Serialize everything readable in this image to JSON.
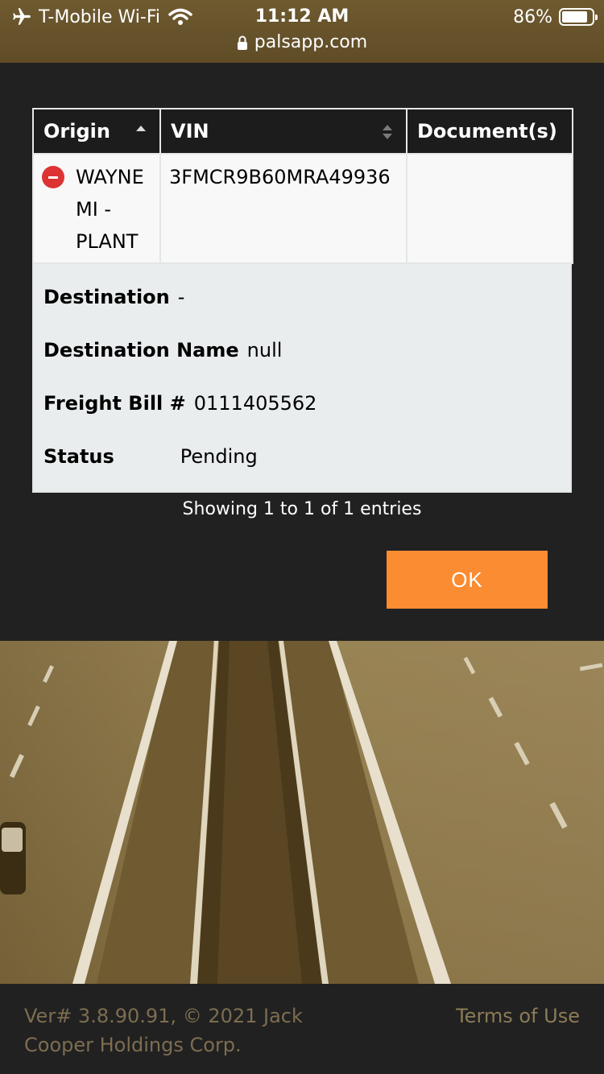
{
  "status_bar": {
    "carrier": "T-Mobile Wi-Fi",
    "time": "11:12 AM",
    "battery": "86%",
    "battery_level": 0.86,
    "url": "palsapp.com"
  },
  "table": {
    "columns": [
      "Origin",
      "VIN",
      "Document(s)"
    ],
    "rows": [
      {
        "origin": "WAYNE MI - PLANT",
        "vin": "3FMCR9B60MRA49936",
        "documents": ""
      }
    ],
    "details": {
      "destination_label": "Destination",
      "destination_value": "-",
      "destination_name_label": "Destination Name",
      "destination_name_value": "null",
      "freight_bill_label": "Freight Bill #",
      "freight_bill_value": "0111405562",
      "status_label": "Status",
      "status_value": "Pending"
    }
  },
  "showing_text": "Showing 1 to 1 of 1 entries",
  "ok_label": "OK",
  "footer": {
    "version": "Ver# 3.8.90.91, © 2021 Jack Cooper Holdings Corp.",
    "terms": "Terms of Use"
  },
  "colors": {
    "status_bar_bg": "#64502a",
    "ok_button": "#fb8c32",
    "remove_icon": "#dd3333"
  }
}
